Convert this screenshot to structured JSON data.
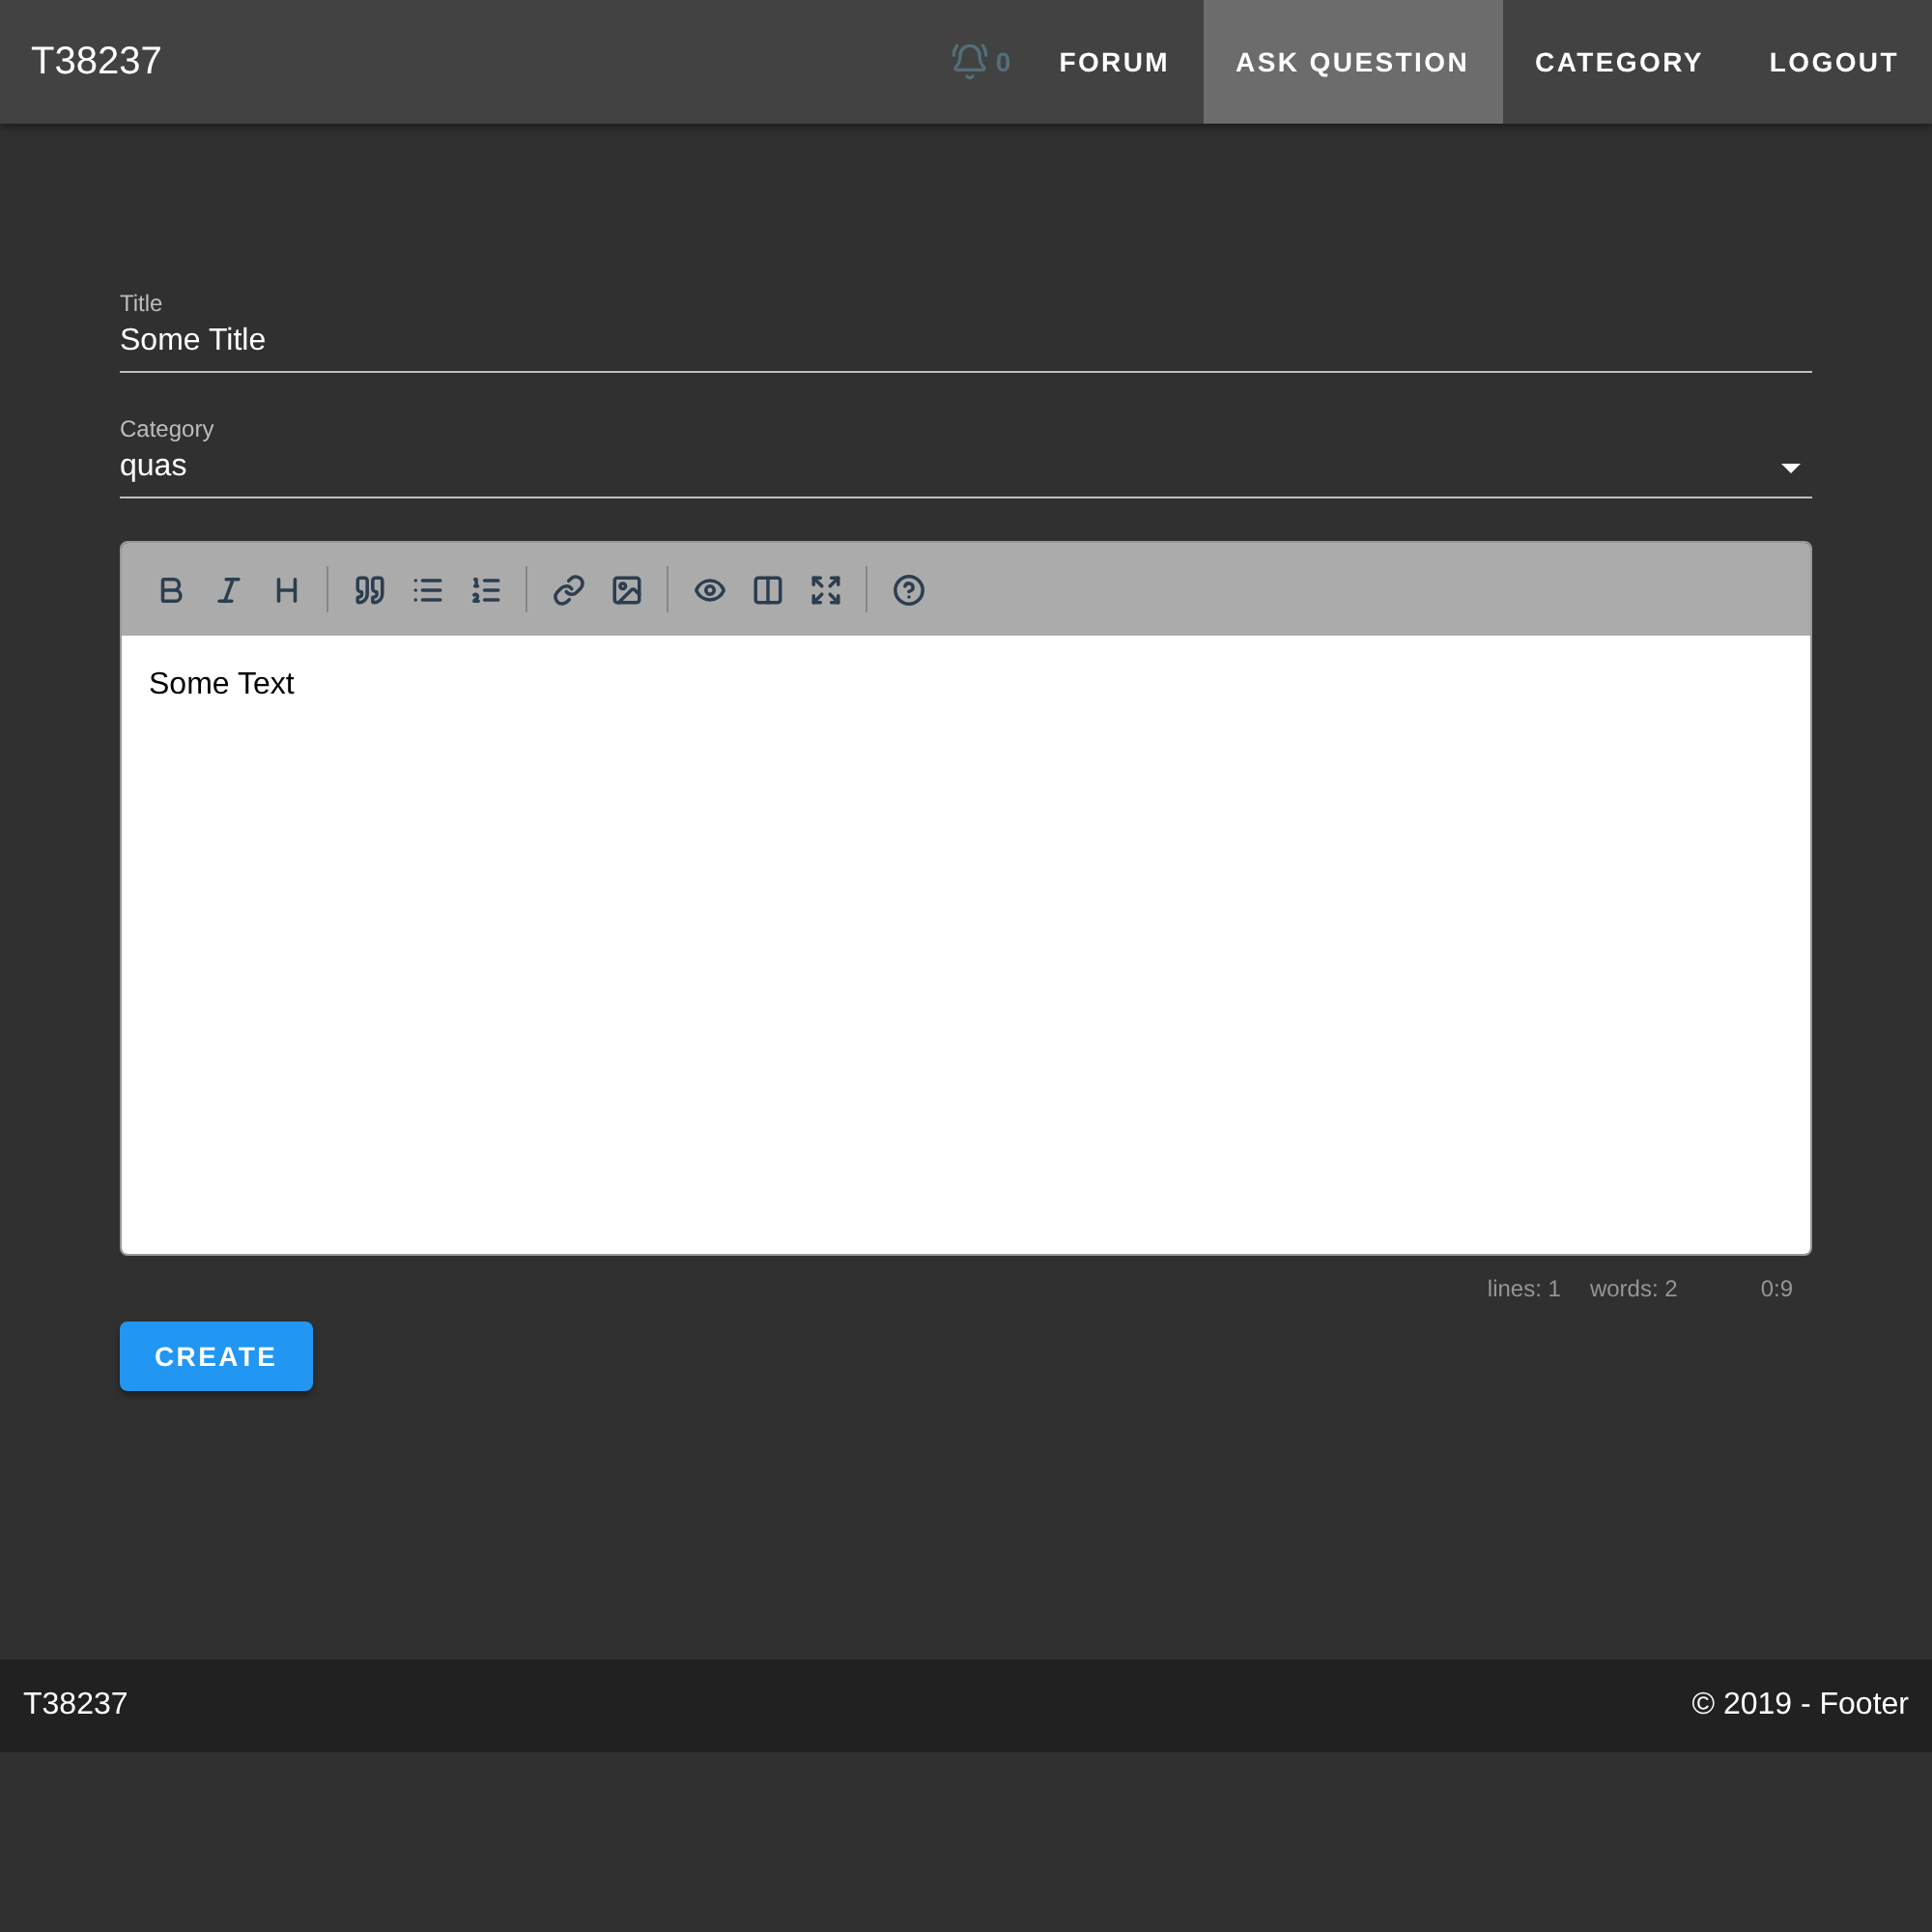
{
  "app_bar": {
    "title": "T38237",
    "notifications": "0",
    "nav": [
      {
        "label": "FORUM",
        "selected": false
      },
      {
        "label": "ASK QUESTION",
        "selected": true
      },
      {
        "label": "CATEGORY",
        "selected": false
      },
      {
        "label": "LOGOUT",
        "selected": false
      }
    ]
  },
  "form": {
    "title_field": {
      "label": "Title",
      "value": "Some Title"
    },
    "category_field": {
      "label": "Category",
      "value": "quas"
    },
    "editor": {
      "text": "Some Text",
      "status": [
        "lines: 1",
        "words: 2",
        "0:9"
      ]
    },
    "submit": "CREATE"
  },
  "footer": {
    "left": "T38237",
    "right": "© 2019 - Footer"
  }
}
